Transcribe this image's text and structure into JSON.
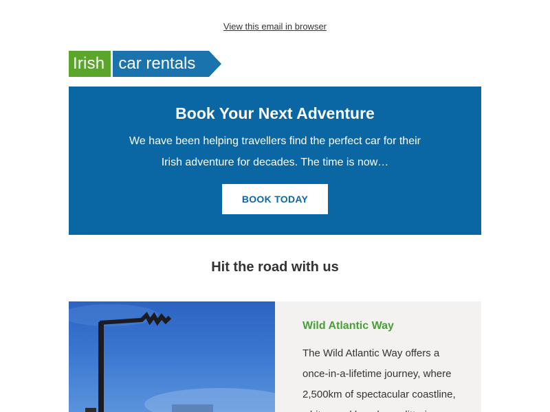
{
  "header": {
    "view_in_browser": "View this email in browser"
  },
  "logo": {
    "word1": "Irish",
    "word2": "car rentals"
  },
  "hero": {
    "title": "Book Your Next Adventure",
    "text_line1": "We have been helping travellers find the perfect car for their",
    "text_line2": "Irish adventure for decades. The time is now…",
    "cta_label": "BOOK TODAY"
  },
  "section": {
    "title": "Hit the road with us"
  },
  "card": {
    "title": "Wild Atlantic Way",
    "text_line1": "The Wild Atlantic Way offers a",
    "text_line2": "once-in-a-lifetime journey, where",
    "text_line3": "2,500km of spectacular coastline,",
    "text_line4": "white sand beaches, glittering"
  },
  "colors": {
    "brand_green": "#5aa62a",
    "brand_blue": "#1b73ad",
    "hero_blue": "#0b67a4",
    "card_title_green": "#4a9e3a",
    "card_bg": "#f3f2f1"
  },
  "icons": {
    "card_image": "wild-atlantic-way-signpost-image"
  }
}
